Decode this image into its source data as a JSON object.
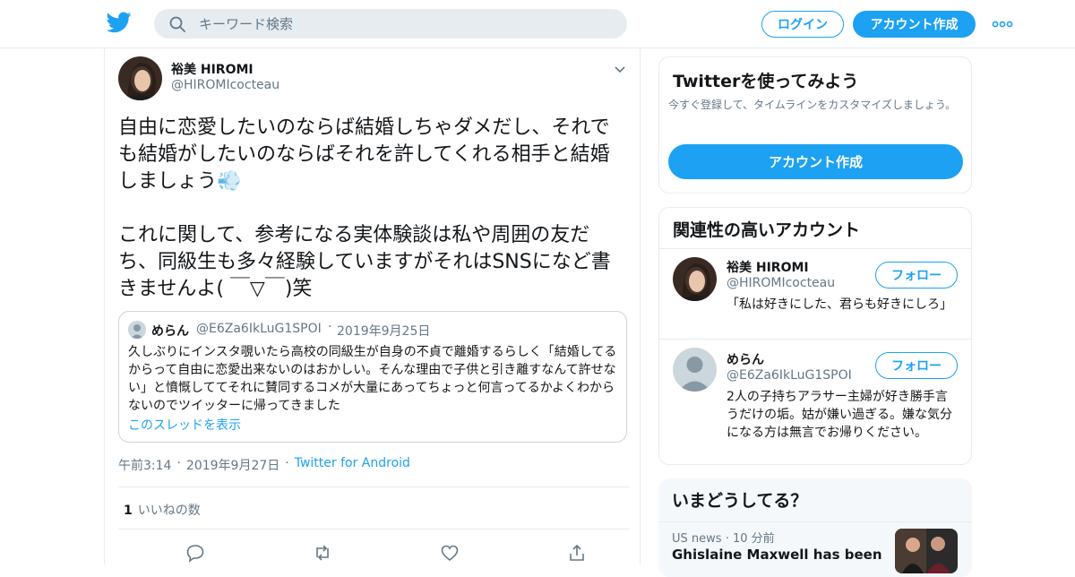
{
  "header": {
    "search_placeholder": "キーワード検索",
    "login_label": "ログイン",
    "signup_label": "アカウント作成",
    "brand_color": "#1da1f2",
    "logo_icon": "twitter-bird-icon",
    "more_icon": "more-dots-icon"
  },
  "tweet": {
    "author_name": "裕美 HIROMI",
    "author_handle": "@HIROMIcocteau",
    "text": "自由に恋愛したいのならば結婚しちゃダメだし、それでも結婚がしたいのならばそれを許してくれる相手と結婚しましょう💨\n\nこれに関して、参考になる実体験談は私や周囲の友だち、同級生も多々経験していますがそれはSNSになど書きませんよ( ￣▽￣)笑",
    "quote": {
      "name": "めらん",
      "handle": "@E6Za6IkLuG1SPOI",
      "dot": "·",
      "date": "2019年9月25日",
      "text": "久しぶりにインスタ覗いたら高校の同級生が自身の不貞で離婚するらしく「結婚してるからって自由に恋愛出来ないのはおかしい。そんな理由で子供と引き離すなんて許せない」と憤慨しててそれに賛同するコメが大量にあってちょっと何言ってるかよくわからないのでツイッターに帰ってきました",
      "thread_link": "このスレッドを表示"
    },
    "time": "午前3:14",
    "dot": "·",
    "date": "2019年9月27日",
    "client": "Twitter for Android",
    "likes_count": "1",
    "likes_label": "いいねの数"
  },
  "sidebar": {
    "promo": {
      "title": "Twitterを使ってみよう",
      "subtitle": "今すぐ登録して、タイムラインをカスタマイズしましょう。",
      "button": "アカウント作成"
    },
    "related": {
      "title": "関連性の高いアカウント",
      "follow_label": "フォロー",
      "accounts": [
        {
          "name": "裕美 HIROMI",
          "handle": "@HIROMIcocteau",
          "bio": "「私は好きにした、君らも好きにしろ」"
        },
        {
          "name": "めらん",
          "handle": "@E6Za6IkLuG1SPOI",
          "bio": "2人の子持ちアラサー主婦が好き勝手言うだけの垢。姑が嫌い過ぎる。嫌な気分になる方は無言でお帰りください。"
        }
      ]
    },
    "trends": {
      "title": "いまどうしてる？",
      "items": [
        {
          "source": "US news",
          "dot": "·",
          "age": "10 分前",
          "headline": "Ghislaine Maxwell has been"
        }
      ]
    }
  }
}
